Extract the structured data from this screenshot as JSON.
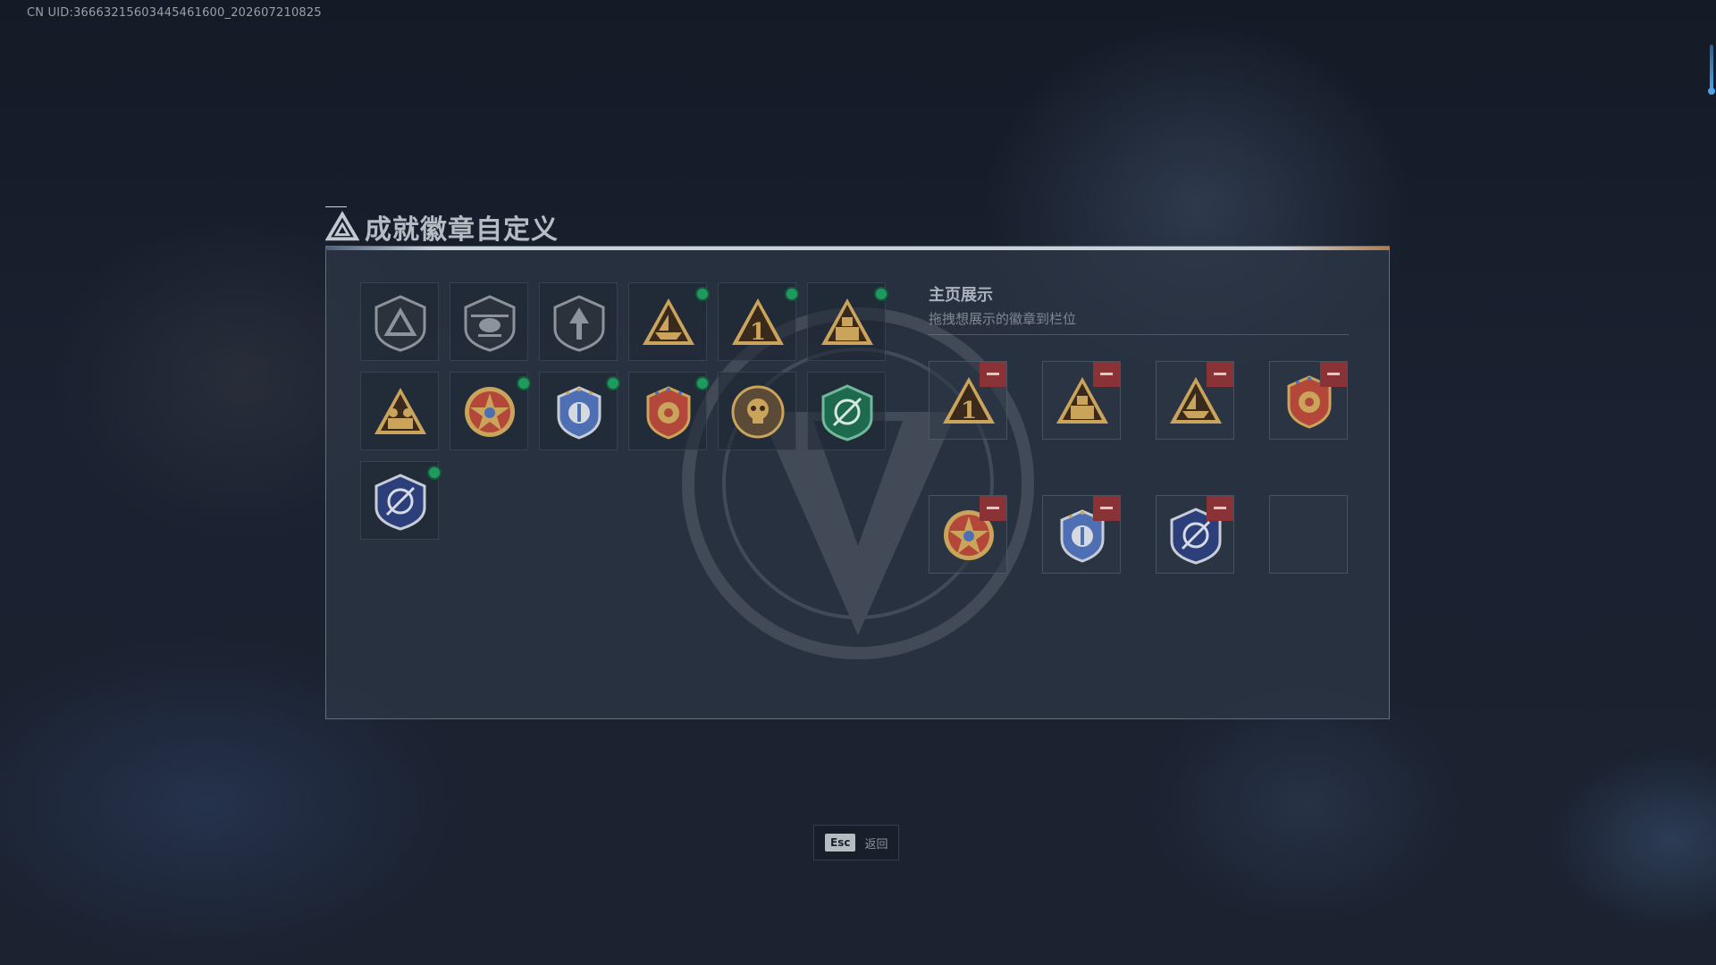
{
  "overlay": {
    "uid_text": "CN UID:36663215603445461600_202607210825"
  },
  "dialog": {
    "title": "成就徽章自定义",
    "badges": [
      {
        "id": "b1",
        "icon": "triangle-shield-badge",
        "new": false
      },
      {
        "id": "b2",
        "icon": "helicopter-shield-badge",
        "new": false
      },
      {
        "id": "b3",
        "icon": "arrow-shield-badge",
        "new": false
      },
      {
        "id": "b4",
        "icon": "ship-triangle-badge",
        "new": true
      },
      {
        "id": "b5",
        "icon": "number-one-triangle-badge",
        "new": true
      },
      {
        "id": "b6",
        "icon": "crate-triangle-badge",
        "new": true
      },
      {
        "id": "b7",
        "icon": "soldiers-triangle-badge",
        "new": false
      },
      {
        "id": "b8",
        "icon": "star-medal-badge",
        "new": true
      },
      {
        "id": "b9",
        "icon": "blue-crest-badge",
        "new": true
      },
      {
        "id": "b10",
        "icon": "orange-crest-badge",
        "new": true
      },
      {
        "id": "b11",
        "icon": "skull-round-badge",
        "new": false
      },
      {
        "id": "b12",
        "icon": "green-compass-shield-badge",
        "new": false
      },
      {
        "id": "b13",
        "icon": "blue-compass-shield-badge",
        "new": true
      }
    ],
    "showcase": {
      "title": "主页展示",
      "subtitle": "拖拽想展示的徽章到栏位",
      "slots": [
        "number-one-triangle-badge",
        "crate-triangle-badge",
        "ship-triangle-badge",
        "orange-crest-badge",
        "star-medal-badge",
        "blue-crest-badge",
        "blue-compass-shield-badge",
        ""
      ]
    }
  },
  "footer": {
    "esc_key": "Esc",
    "esc_label": "返回"
  },
  "colors": {
    "accent_gold": "#c9a45a",
    "new_dot": "#1f9a5e",
    "remove": "#8a3336"
  }
}
